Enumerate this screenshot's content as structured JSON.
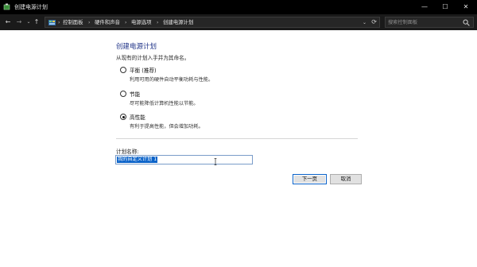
{
  "window": {
    "title": "创建电源计划",
    "controls": {
      "minimize": "—",
      "maximize": "☐",
      "close": "✕"
    }
  },
  "toolbar": {
    "back": "←",
    "forward": "→",
    "recent": "⌄",
    "up": "↑",
    "breadcrumb": [
      "控制面板",
      "硬件和声音",
      "电源选项",
      "创建电源计划"
    ],
    "separator": "›",
    "dropdown": "⌄",
    "refresh": "⟳",
    "search_placeholder": "搜索控制面板"
  },
  "main": {
    "title": "创建电源计划",
    "subtitle": "从现有的计划入手并为其命名。",
    "options": [
      {
        "label": "平衡 (推荐)",
        "description": "利用可用的硬件自动平衡功耗与性能。",
        "checked": false
      },
      {
        "label": "节能",
        "description": "尽可能降低计算机性能以节能。",
        "checked": false
      },
      {
        "label": "高性能",
        "description": "有利于提高性能，但会增加功耗。",
        "checked": true
      }
    ],
    "name_label": "计划名称:",
    "name_value": "我的自定义计划 1",
    "next_button": "下一页",
    "cancel_button": "取消"
  },
  "colors": {
    "title_blue": "#1e3287",
    "selection": "#0b63c9",
    "titlebar": "#000000",
    "toolbar": "#1a1a1a"
  },
  "icons": {
    "app": "power-options-icon",
    "address": "control-panel-icon",
    "search": "search-icon",
    "cursor": "text-cursor-icon"
  }
}
